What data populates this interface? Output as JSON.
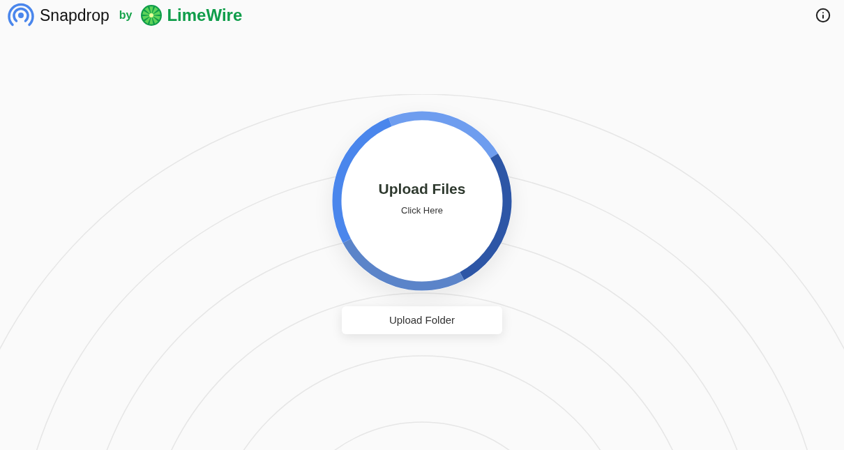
{
  "header": {
    "brand": "Snapdrop",
    "by": "by",
    "partner": "LimeWire"
  },
  "upload": {
    "title": "Upload Files",
    "subtitle": "Click Here"
  },
  "folder_button": {
    "label": "Upload Folder"
  }
}
